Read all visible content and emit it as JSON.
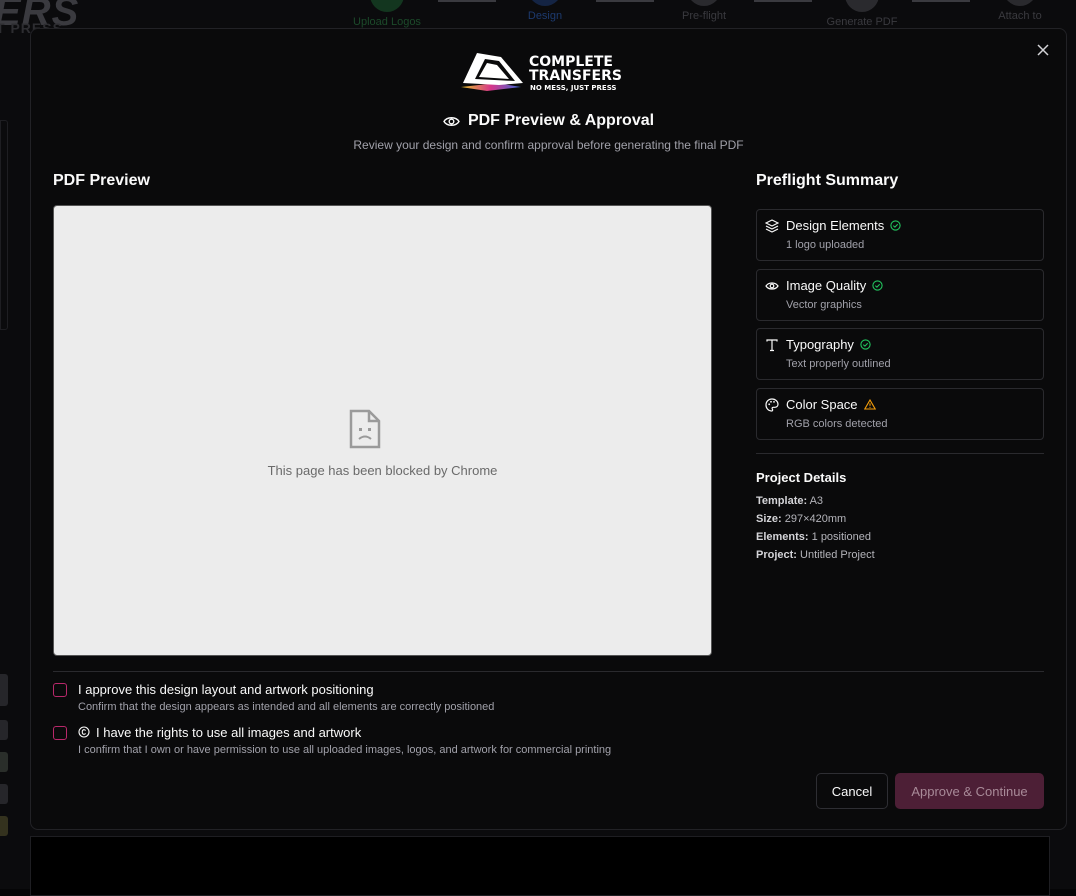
{
  "background": {
    "brand_text": "ERS",
    "brand_sub": "T PRESS",
    "steps": [
      {
        "label": "Upload Logos"
      },
      {
        "label": "Design"
      },
      {
        "label": "Pre-flight"
      },
      {
        "label": "Generate PDF"
      },
      {
        "label": "Attach to"
      }
    ]
  },
  "modal": {
    "logo": {
      "line1": "COMPLETE",
      "line2": "TRANSFERS",
      "tagline": "NO MESS, JUST PRESS"
    },
    "title": "PDF Preview & Approval",
    "subtitle": "Review your design and confirm approval before generating the final PDF",
    "preview": {
      "heading": "PDF Preview",
      "blocked_message": "This page has been blocked by Chrome"
    },
    "preflight": {
      "heading": "Preflight Summary",
      "items": [
        {
          "title": "Design Elements",
          "subtitle": "1 logo uploaded",
          "icon": "layers-icon",
          "status": "ok"
        },
        {
          "title": "Image Quality",
          "subtitle": "Vector graphics",
          "icon": "eye-icon",
          "status": "ok"
        },
        {
          "title": "Typography",
          "subtitle": "Text properly outlined",
          "icon": "type-icon",
          "status": "ok"
        },
        {
          "title": "Color Space",
          "subtitle": "RGB colors detected",
          "icon": "palette-icon",
          "status": "warning"
        }
      ]
    },
    "project_details": {
      "heading": "Project Details",
      "rows": [
        {
          "label": "Template:",
          "value": "A3"
        },
        {
          "label": "Size:",
          "value": "297×420mm"
        },
        {
          "label": "Elements:",
          "value": "1 positioned"
        },
        {
          "label": "Project:",
          "value": "Untitled Project"
        }
      ]
    },
    "approvals": [
      {
        "label": "I approve this design layout and artwork positioning",
        "description": "Confirm that the design appears as intended and all elements are correctly positioned",
        "checked": false
      },
      {
        "label": "I have the rights to use all images and artwork",
        "description": "I confirm that I own or have permission to use all uploaded images, logos, and artwork for commercial printing",
        "checked": false
      }
    ],
    "buttons": {
      "cancel": "Cancel",
      "approve": "Approve & Continue"
    }
  },
  "colors": {
    "accent": "#b8286a",
    "ok": "#22c55e",
    "warning": "#f59e0b"
  }
}
